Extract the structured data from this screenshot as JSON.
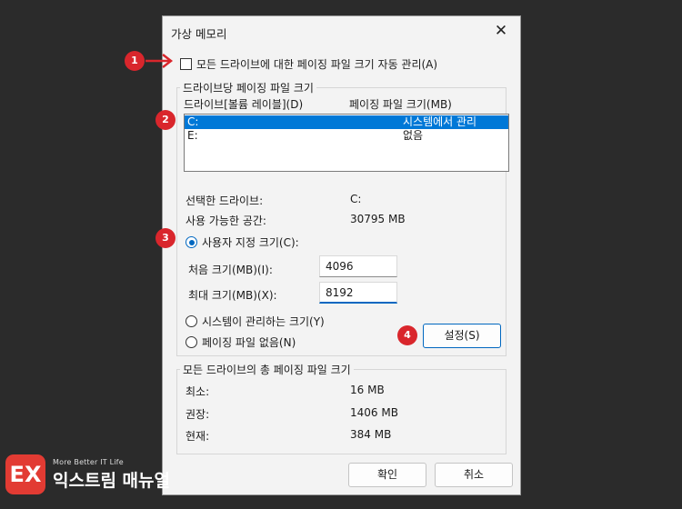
{
  "dialog": {
    "title": "가상 메모리",
    "close_glyph": "✕",
    "auto_manage_label": "모든 드라이브에 대한 페이징 파일 크기 자동 관리(A)",
    "auto_manage_checked": false
  },
  "per_drive": {
    "group_title": "드라이브당 페이징 파일 크기",
    "col_drive": "드라이브[볼륨 레이블](D)",
    "col_size": "페이징 파일 크기(MB)",
    "rows": [
      {
        "drive": "C:",
        "size": "시스템에서 관리",
        "selected": true
      },
      {
        "drive": "E:",
        "size": "없음",
        "selected": false
      }
    ],
    "selected_drive_label": "선택한 드라이브:",
    "selected_drive_value": "C:",
    "available_label": "사용 가능한 공간:",
    "available_value": "30795 MB",
    "custom_size_label": "사용자 지정 크기(C):",
    "initial_label": "처음 크기(MB)(I):",
    "initial_value": "4096",
    "max_label": "최대 크기(MB)(X):",
    "max_value": "8192",
    "system_managed_label": "시스템이 관리하는 크기(Y)",
    "no_paging_label": "페이징 파일 없음(N)",
    "selected_option": "custom",
    "set_button": "설정(S)"
  },
  "total": {
    "group_title": "모든 드라이브의 총 페이징 파일 크기",
    "min_label": "최소:",
    "min_value": "16 MB",
    "recommended_label": "권장:",
    "recommended_value": "1406 MB",
    "current_label": "현재:",
    "current_value": "384 MB"
  },
  "buttons": {
    "ok": "확인",
    "cancel": "취소"
  },
  "badges": [
    "1",
    "2",
    "3",
    "4"
  ],
  "logo": {
    "tagline": "More Better IT Life",
    "name": "익스트림 매뉴얼",
    "mark": "EX"
  },
  "colors": {
    "accent": "#0078d7",
    "badge": "#d9262c",
    "background": "#2b2b2b"
  }
}
